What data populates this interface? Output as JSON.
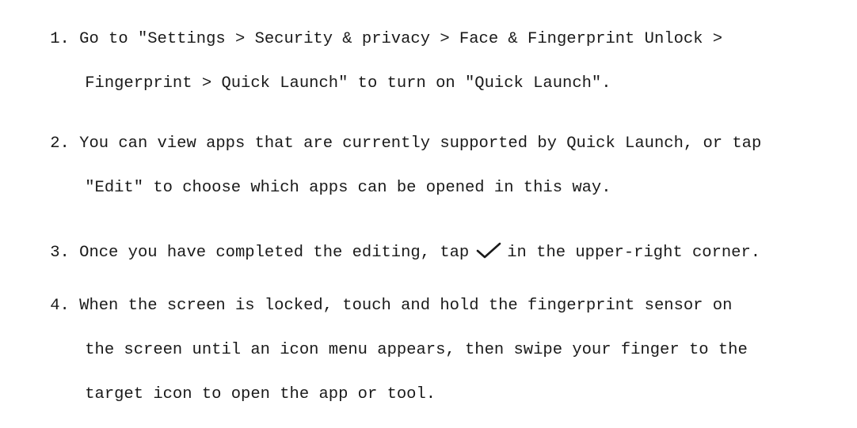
{
  "steps": [
    {
      "number": "1.",
      "line1": "Go to \"Settings > Security & privacy > Face & Fingerprint Unlock >",
      "line2": "Fingerprint > Quick Launch\" to turn on \"Quick Launch\"."
    },
    {
      "number": "2.",
      "line1": "You can view apps that are currently supported by Quick Launch, or tap",
      "line2": "\"Edit\" to choose which apps can be opened in this way."
    },
    {
      "number": "3.",
      "before_icon": "Once you have completed the editing, tap",
      "icon": "checkmark-icon",
      "after_icon": "in the upper-right corner."
    },
    {
      "number": "4.",
      "line1": "When the screen is locked, touch and hold the fingerprint sensor on",
      "line2": "the screen until an icon menu appears, then swipe your finger to the",
      "line3": "target icon to open the app or tool."
    }
  ]
}
